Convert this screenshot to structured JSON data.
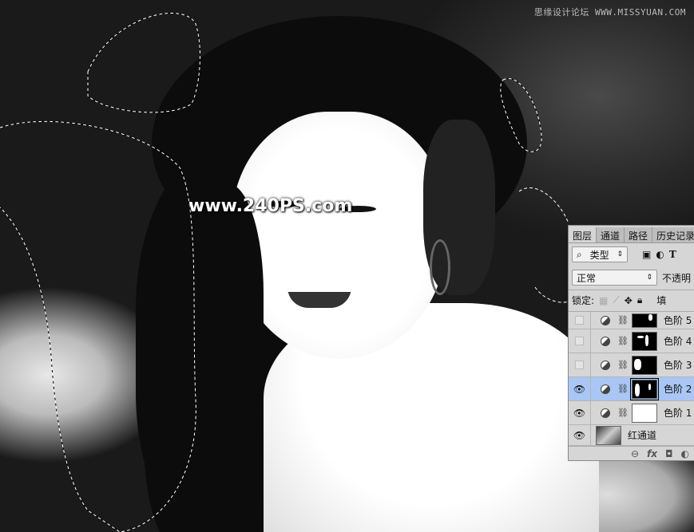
{
  "watermarks": {
    "top_cn": "思缘设计论坛",
    "top_url": "WWW.MISSYUAN.COM",
    "center": "www.240PS.com"
  },
  "layers_panel": {
    "tabs": [
      "图层",
      "通道",
      "路径",
      "历史记录"
    ],
    "filter": {
      "label": "类型",
      "icons": [
        "image-filter-icon",
        "adjustment-filter-icon",
        "type-filter-icon"
      ],
      "type_glyph": "T"
    },
    "blend_mode": "正常",
    "opacity_label": "不透明",
    "lock_label": "锁定:",
    "fill_label": "填",
    "layers": [
      {
        "name": "色阶 5",
        "visible": false,
        "mask": "black",
        "selected": false
      },
      {
        "name": "色阶 4",
        "visible": false,
        "mask": "black",
        "selected": false
      },
      {
        "name": "色阶 3",
        "visible": false,
        "mask": "black",
        "selected": false
      },
      {
        "name": "色阶 2",
        "visible": true,
        "mask": "black",
        "selected": true
      },
      {
        "name": "色阶 1",
        "visible": true,
        "mask": "white",
        "selected": false
      },
      {
        "name": "红通道",
        "visible": true,
        "mask": "photo",
        "selected": false
      }
    ],
    "bottom_fx": "fx"
  }
}
